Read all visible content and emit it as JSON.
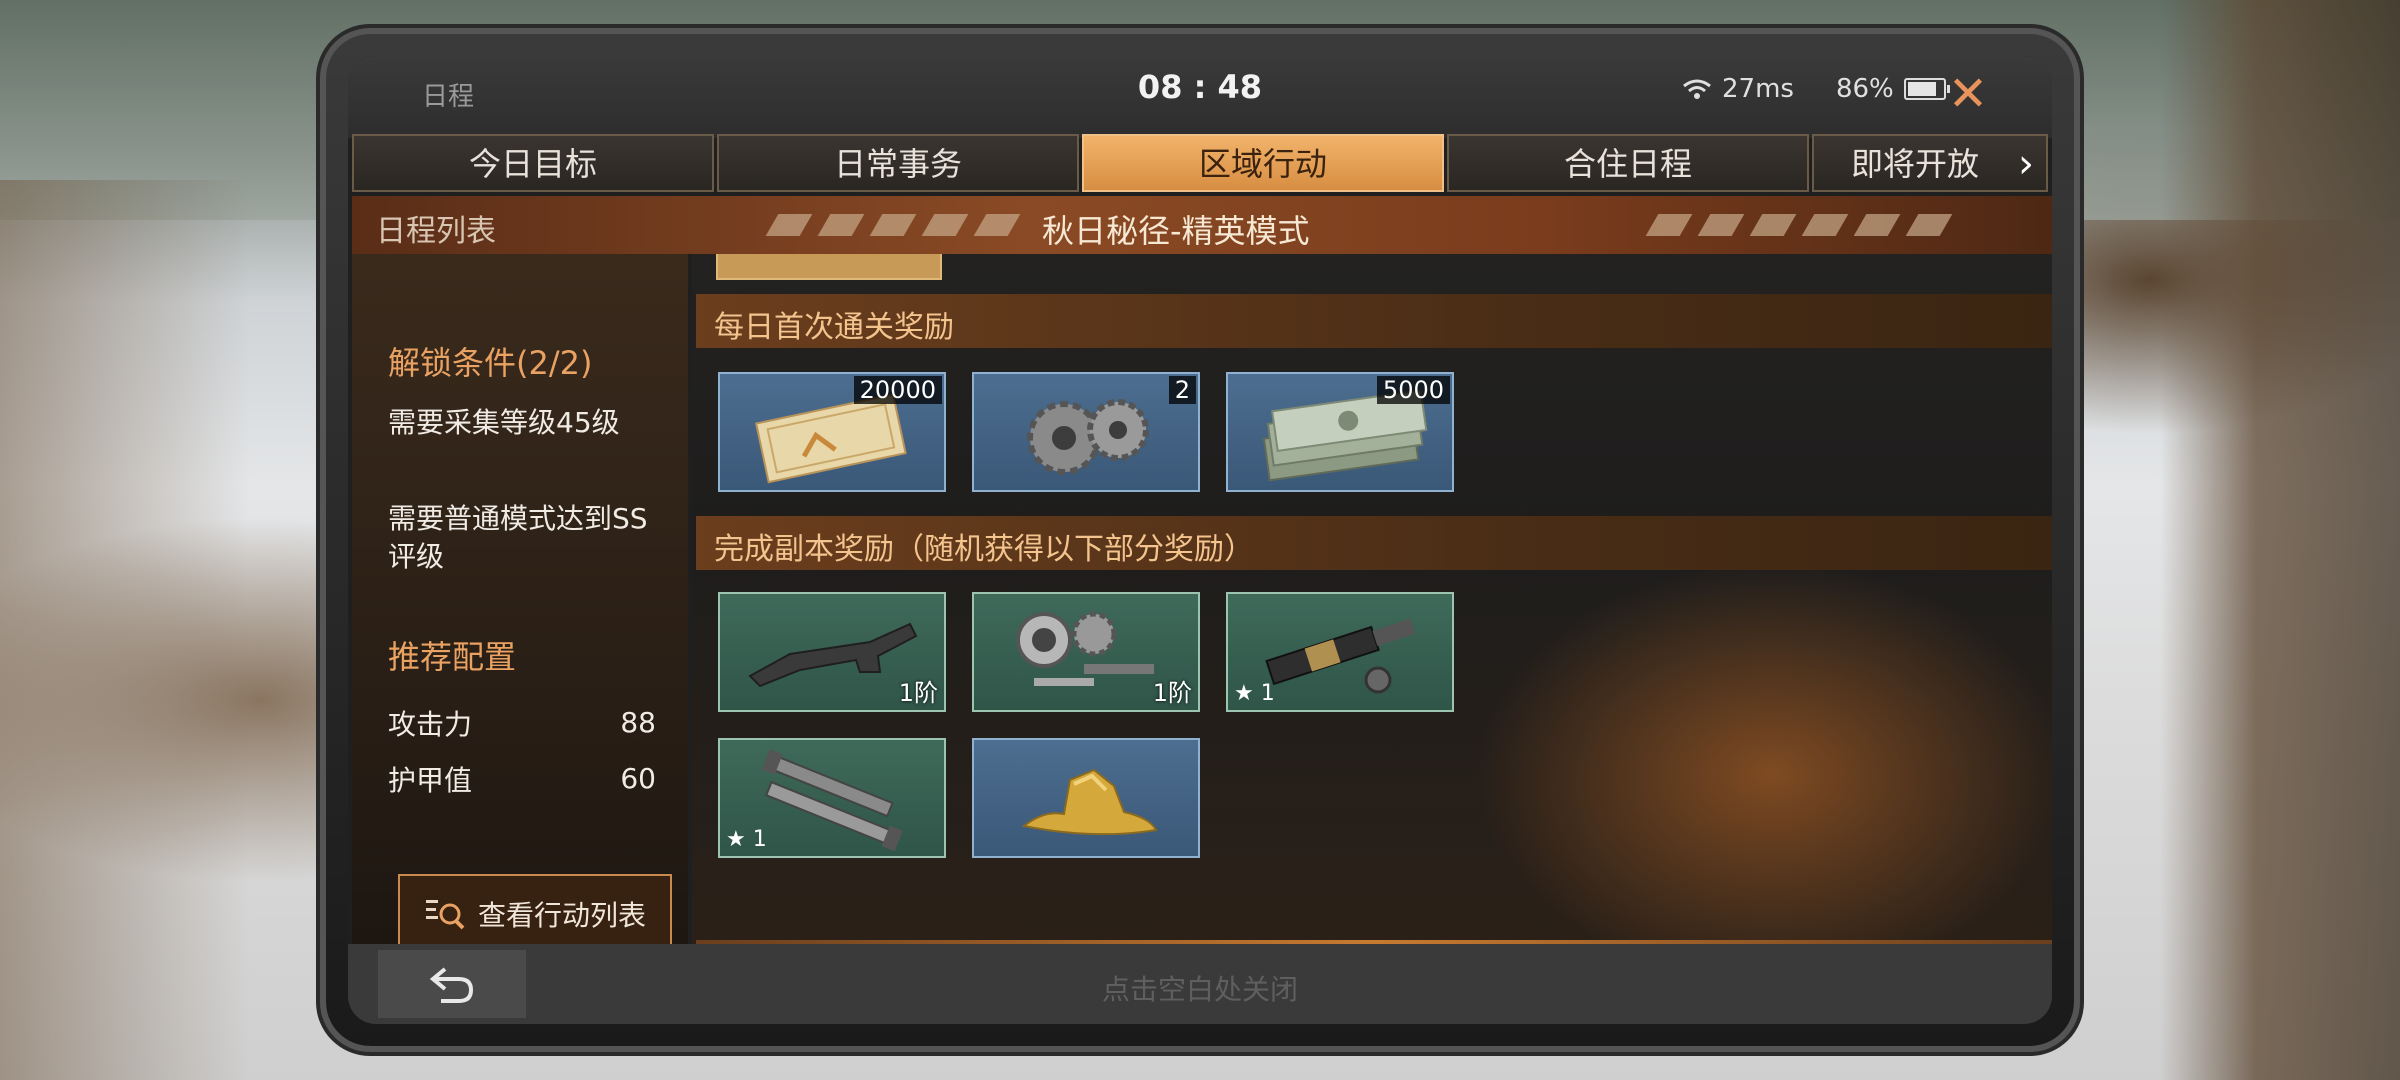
{
  "status_bar": {
    "title": "日程",
    "time": "08 : 48",
    "ping": "27ms",
    "battery": "86%"
  },
  "tabs": [
    {
      "label": "今日目标"
    },
    {
      "label": "日常事务"
    },
    {
      "label": "区域行动"
    },
    {
      "label": "合住日程"
    },
    {
      "label": "即将开放"
    }
  ],
  "banner": {
    "left_label": "日程列表",
    "title": "秋日秘径-精英模式"
  },
  "left_panel": {
    "unlock_title": "解锁条件(2/2)",
    "cond1": "需要采集等级45级",
    "cond2_line1": "需要普通模式达到SS",
    "cond2_line2": "评级",
    "rec_title": "推荐配置",
    "attack_label": "攻击力",
    "attack_value": "88",
    "armor_label": "护甲值",
    "armor_value": "60",
    "button": "查看行动列表"
  },
  "rewards": {
    "daily_title": "每日首次通关奖励",
    "daily_items": [
      {
        "name": "certificate",
        "count": "20000"
      },
      {
        "name": "gears",
        "count": "2"
      },
      {
        "name": "cash",
        "count": "5000"
      }
    ],
    "clear_title": "完成副本奖励（随机获得以下部分奖励）",
    "clear_items": [
      {
        "name": "gun-stock",
        "tier": "1阶"
      },
      {
        "name": "bearing-parts",
        "tier": "1阶"
      },
      {
        "name": "barrel-parts",
        "star": "1"
      },
      {
        "name": "bolts",
        "star": "1"
      },
      {
        "name": "gold-nugget"
      }
    ]
  },
  "bottom": {
    "hint": "点击空白处关闭"
  },
  "colors": {
    "accent": "#e9a262",
    "active_tab": "#e8a154",
    "item_blue": "#4d6e90",
    "item_green": "#3f6a5a"
  }
}
